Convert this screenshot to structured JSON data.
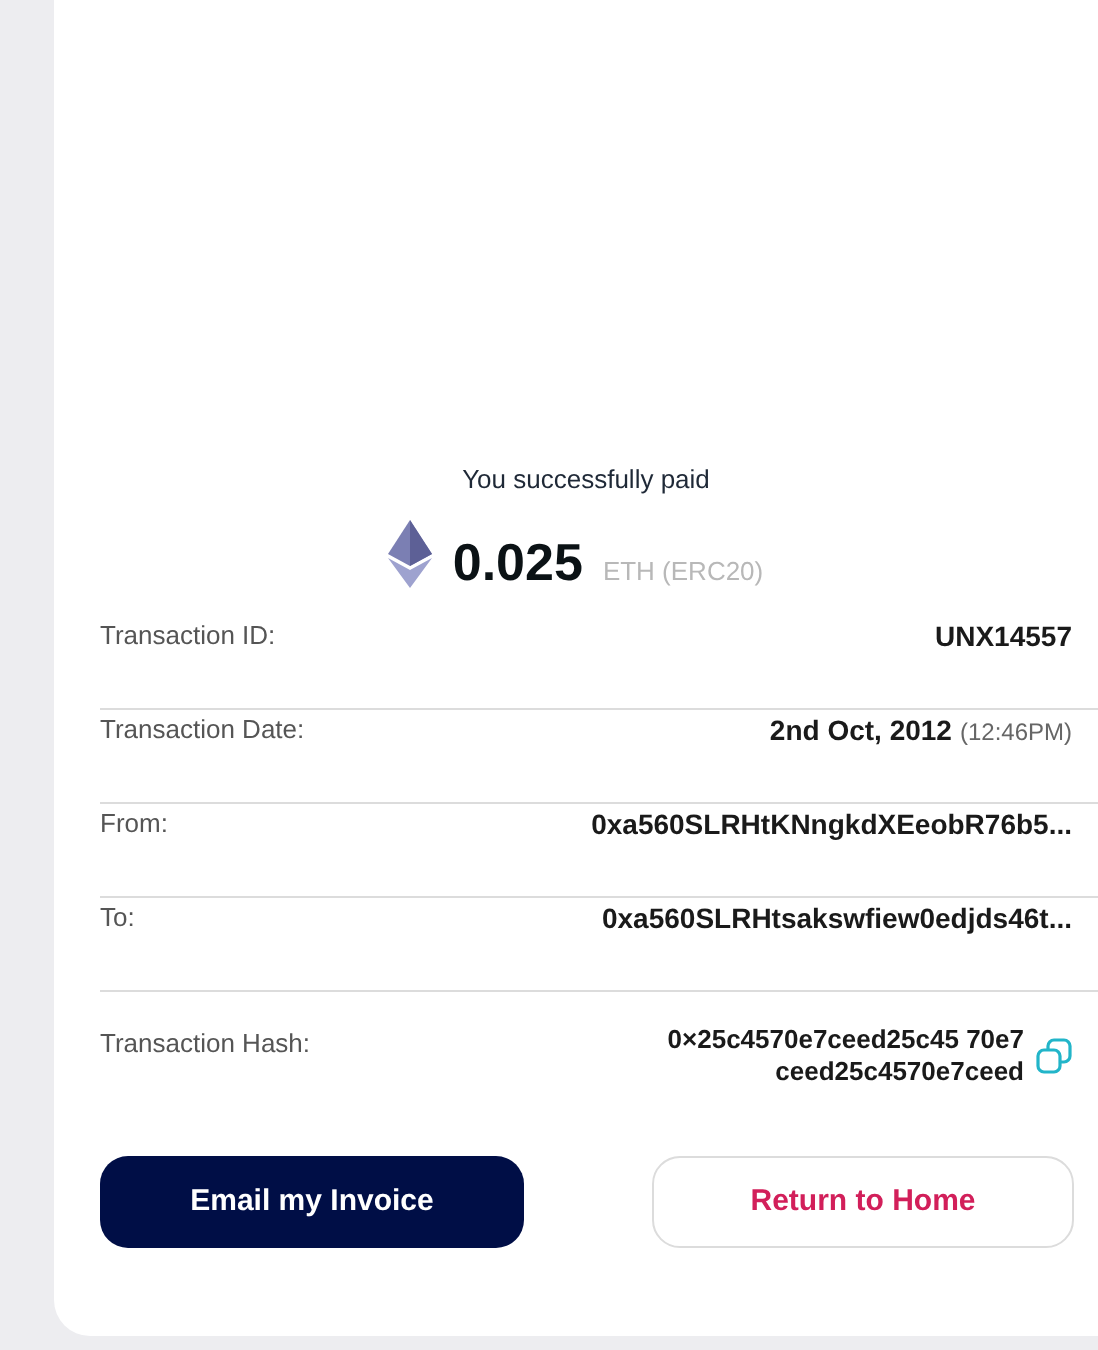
{
  "header": {
    "title": "You successfully paid",
    "amount": "0.025",
    "unit": "ETH (ERC20)"
  },
  "details": [
    {
      "kind": "text",
      "label": "Transaction ID:",
      "value": "UNX14557"
    },
    {
      "kind": "date",
      "label": "Transaction Date:",
      "value": "2nd Oct, 2012",
      "note": "(12:46PM)"
    },
    {
      "kind": "text",
      "label": "From:",
      "value": "0xa560SLRHtKNngkdXEeobR76b5..."
    },
    {
      "kind": "text",
      "label": "To:",
      "value": "0xa560SLRHtsakswfiew0edjds46t..."
    },
    {
      "kind": "hash",
      "label": "Transaction Hash:",
      "value": "0×25c4570e7ceed25c45 70e7ceed25c4570e7ceed"
    }
  ],
  "buttons": [
    {
      "kind": "primary",
      "label": "Email my Invoice"
    },
    {
      "kind": "secondary",
      "label": "Return to Home"
    }
  ]
}
